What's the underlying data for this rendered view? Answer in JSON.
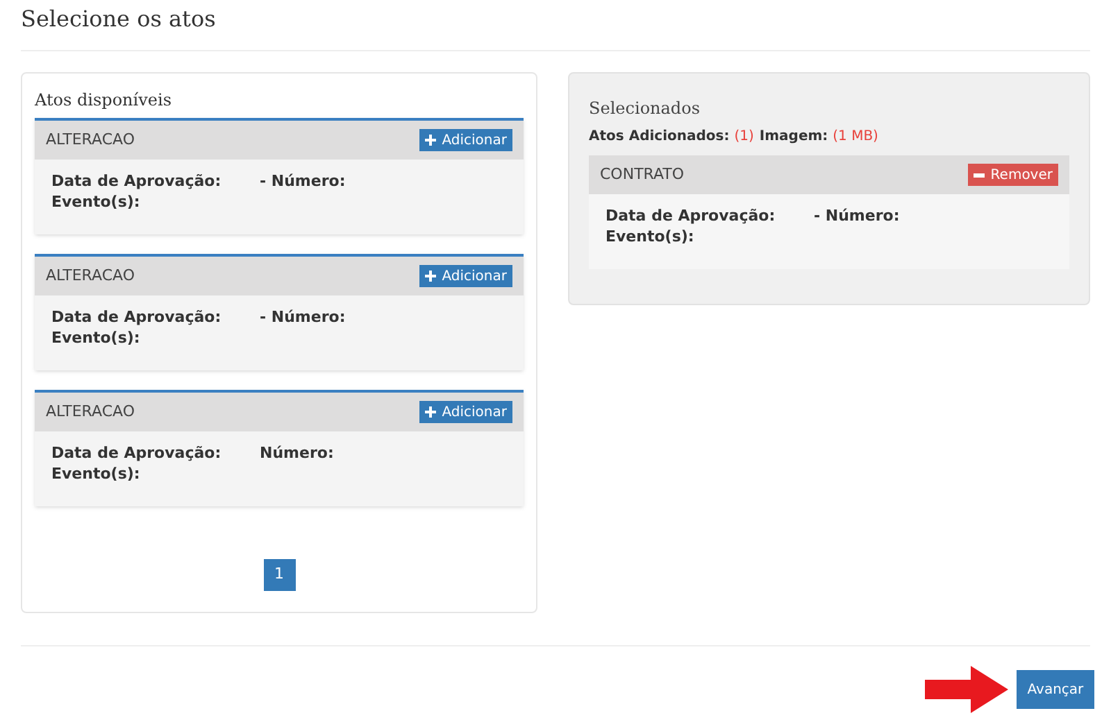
{
  "title": "Selecione os atos",
  "available": {
    "heading": "Atos disponíveis",
    "cards": [
      {
        "name": "ALTERACAO",
        "button": "Adicionar",
        "date_label": "Data de Aprovação:",
        "number_label": "- Número:",
        "events_label": "Evento(s):"
      },
      {
        "name": "ALTERACAO",
        "button": "Adicionar",
        "date_label": "Data de Aprovação:",
        "number_label": "- Número:",
        "events_label": "Evento(s):"
      },
      {
        "name": "ALTERACAO",
        "button": "Adicionar",
        "date_label": "Data de Aprovação:",
        "number_label": "Número:",
        "events_label": "Evento(s):"
      }
    ],
    "pages": [
      {
        "label": "1",
        "selected": true
      }
    ]
  },
  "selected": {
    "heading": "Selecionados",
    "summary": [
      {
        "label": "Atos Adicionados:",
        "value": "(1)"
      },
      {
        "label": "Imagem:",
        "value": "(1 MB)"
      }
    ],
    "cards": [
      {
        "name": "CONTRATO",
        "button": "Remover",
        "date_label": "Data de Aprovação:",
        "number_label": "- Número:",
        "events_label": "Evento(s):"
      }
    ]
  },
  "next_button": "Avançar"
}
